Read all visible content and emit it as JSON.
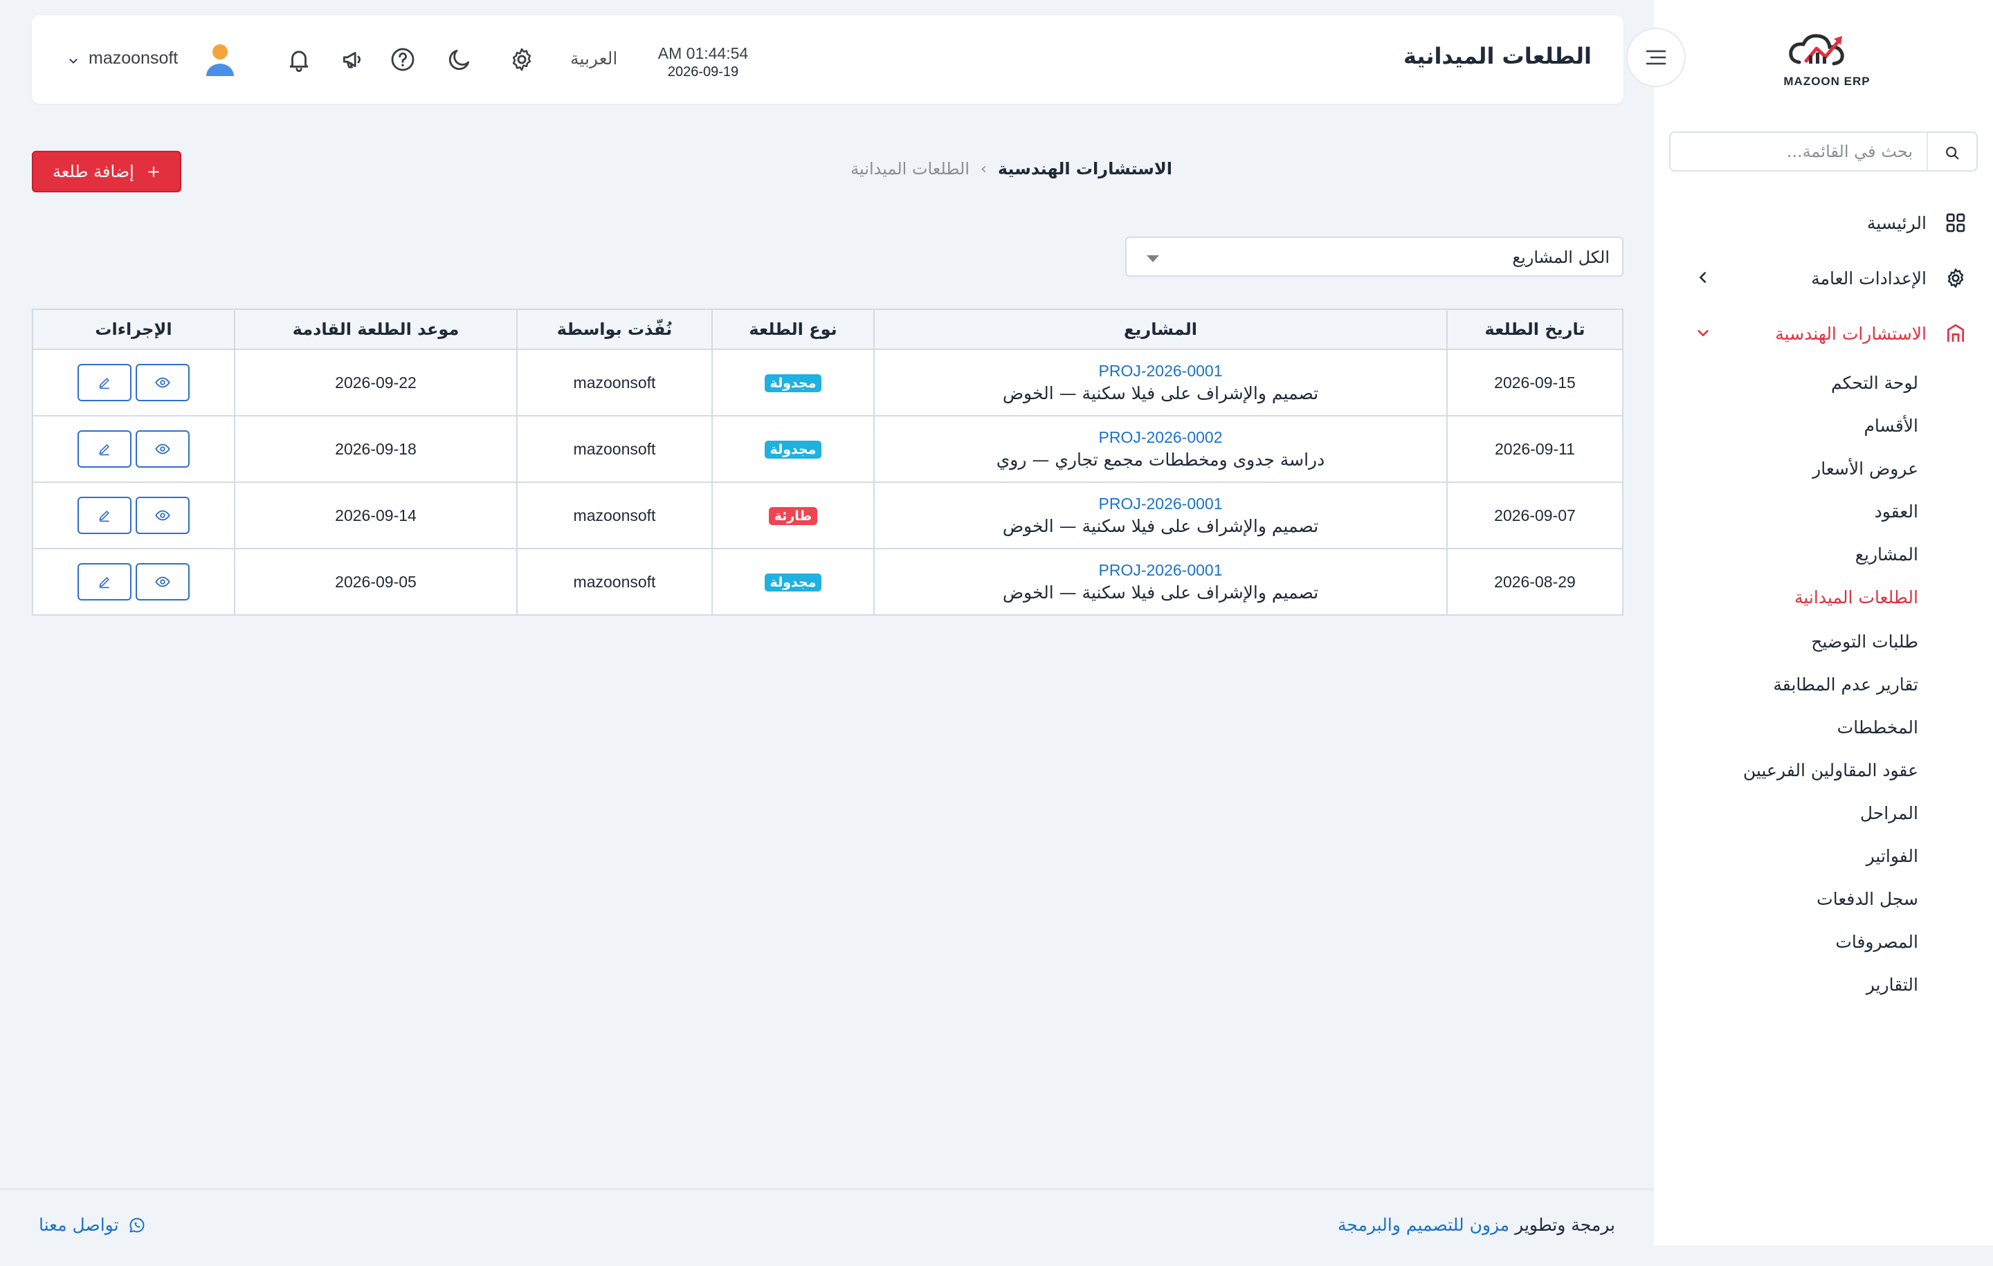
{
  "app": {
    "logo_text": "MAZOON ERP",
    "brand_colors": {
      "accent": "#e2303e",
      "link": "#1a73c8",
      "badge_scheduled": "#1fb1e0",
      "badge_urgent": "#f04452"
    }
  },
  "sidebar": {
    "search_placeholder": "بحث في القائمة...",
    "main_items": [
      {
        "label": "الرئيسية",
        "icon": "grid-icon"
      },
      {
        "label": "الإعدادات العامة",
        "icon": "gear-icon"
      },
      {
        "label": "الاستشارات الهندسية",
        "icon": "building-icon"
      }
    ],
    "sub_items": [
      {
        "label": "لوحة التحكم"
      },
      {
        "label": "الأقسام"
      },
      {
        "label": "عروض الأسعار"
      },
      {
        "label": "العقود"
      },
      {
        "label": "المشاريع"
      },
      {
        "label": "الطلعات الميدانية"
      },
      {
        "label": "طلبات التوضيح"
      },
      {
        "label": "تقارير عدم المطابقة"
      },
      {
        "label": "المخططات"
      },
      {
        "label": "عقود المقاولين الفرعيين"
      },
      {
        "label": "المراحل"
      },
      {
        "label": "الفواتير"
      },
      {
        "label": "سجل الدفعات"
      },
      {
        "label": "المصروفات"
      },
      {
        "label": "التقارير"
      }
    ]
  },
  "header": {
    "title": "الطلعات الميدانية",
    "time": "AM 01:44:54",
    "date": "2026-09-19",
    "language": "العربية",
    "user_name": "mazoonsoft"
  },
  "breadcrumb": {
    "section": "الاستشارات الهندسية",
    "separator": "›",
    "page": "الطلعات الميدانية"
  },
  "toolbar": {
    "add_label": "إضافة طلعة",
    "add_icon": "+"
  },
  "filter": {
    "selected": "الكل المشاريع"
  },
  "table": {
    "headers": [
      "تاريخ الطلعة",
      "المشاريع",
      "نوع الطلعة",
      "نُفّذت بواسطة",
      "موعد الطلعة القادمة",
      "الإجراءات"
    ],
    "rows": [
      {
        "date": "2026-09-15",
        "project_code": "PROJ-2026-0001",
        "project_name": "تصميم والإشراف على فيلا سكنية — الخوض",
        "type": "مجدولة",
        "by": "mazoonsoft",
        "next": "2026-09-22"
      },
      {
        "date": "2026-09-11",
        "project_code": "PROJ-2026-0002",
        "project_name": "دراسة جدوى ومخططات مجمع تجاري — روي",
        "type": "مجدولة",
        "by": "mazoonsoft",
        "next": "2026-09-18"
      },
      {
        "date": "2026-09-07",
        "project_code": "PROJ-2026-0001",
        "project_name": "تصميم والإشراف على فيلا سكنية — الخوض",
        "type": "طارئة",
        "by": "mazoonsoft",
        "next": "2026-09-14"
      },
      {
        "date": "2026-08-29",
        "project_code": "PROJ-2026-0001",
        "project_name": "تصميم والإشراف على فيلا سكنية — الخوض",
        "type": "مجدولة",
        "by": "mazoonsoft",
        "next": "2026-09-05"
      }
    ]
  },
  "footer": {
    "credit_text": "برمجة وتطوير",
    "credit_link": "مزون للتصميم والبرمجة",
    "contact": "تواصل معنا"
  }
}
